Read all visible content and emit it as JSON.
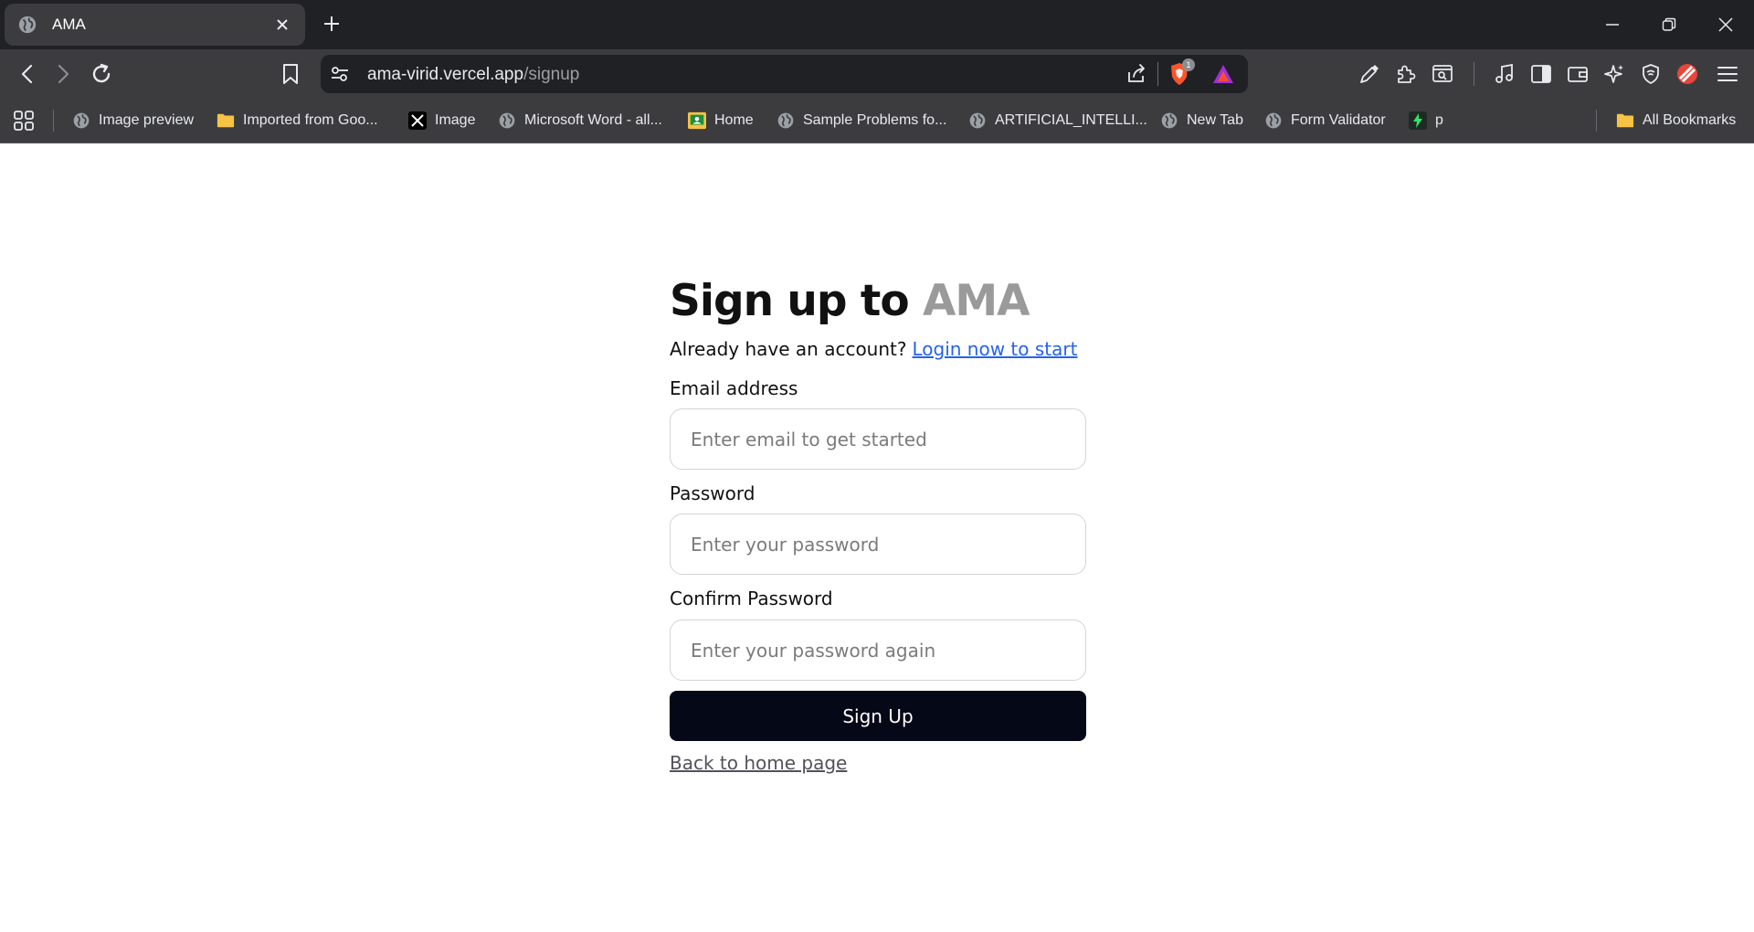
{
  "browser": {
    "tab": {
      "title": "AMA"
    },
    "address_bar": {
      "host": "ama-virid.vercel.app",
      "path": "/signup"
    },
    "shields_badge_count": "1",
    "bookmarks": [
      {
        "label": "Image preview",
        "icon": "globe-icon"
      },
      {
        "label": "Imported from Goo...",
        "icon": "folder-icon"
      },
      {
        "label": "Image",
        "icon": "x-logo-icon"
      },
      {
        "label": "Microsoft Word - all...",
        "icon": "globe-icon"
      },
      {
        "label": "Home",
        "icon": "classroom-icon"
      },
      {
        "label": "Sample Problems fo...",
        "icon": "globe-icon"
      },
      {
        "label": "ARTIFICIAL_INTELLI...",
        "icon": "globe-icon"
      },
      {
        "label": "New Tab",
        "icon": "globe-icon"
      },
      {
        "label": "Form Validator",
        "icon": "globe-icon"
      },
      {
        "label": "p",
        "icon": "bolt-icon"
      }
    ],
    "all_bookmarks_label": "All Bookmarks"
  },
  "signup": {
    "heading_prefix": "Sign up to ",
    "heading_brand": "AMA",
    "account_prompt": "Already have an account?",
    "login_link": "Login now to start",
    "email_label": "Email address",
    "email_placeholder": "Enter email to get started",
    "password_label": "Password",
    "password_placeholder": "Enter your password",
    "confirm_label": "Confirm Password",
    "confirm_placeholder": "Enter your password again",
    "submit_label": "Sign Up",
    "back_link": "Back to home page"
  },
  "colors": {
    "chrome_dark": "#202124",
    "chrome_toolbar": "#3c3c3f",
    "link_blue": "#2563eb",
    "button_dark": "#050816",
    "brand_gray": "#9a9a9a"
  }
}
